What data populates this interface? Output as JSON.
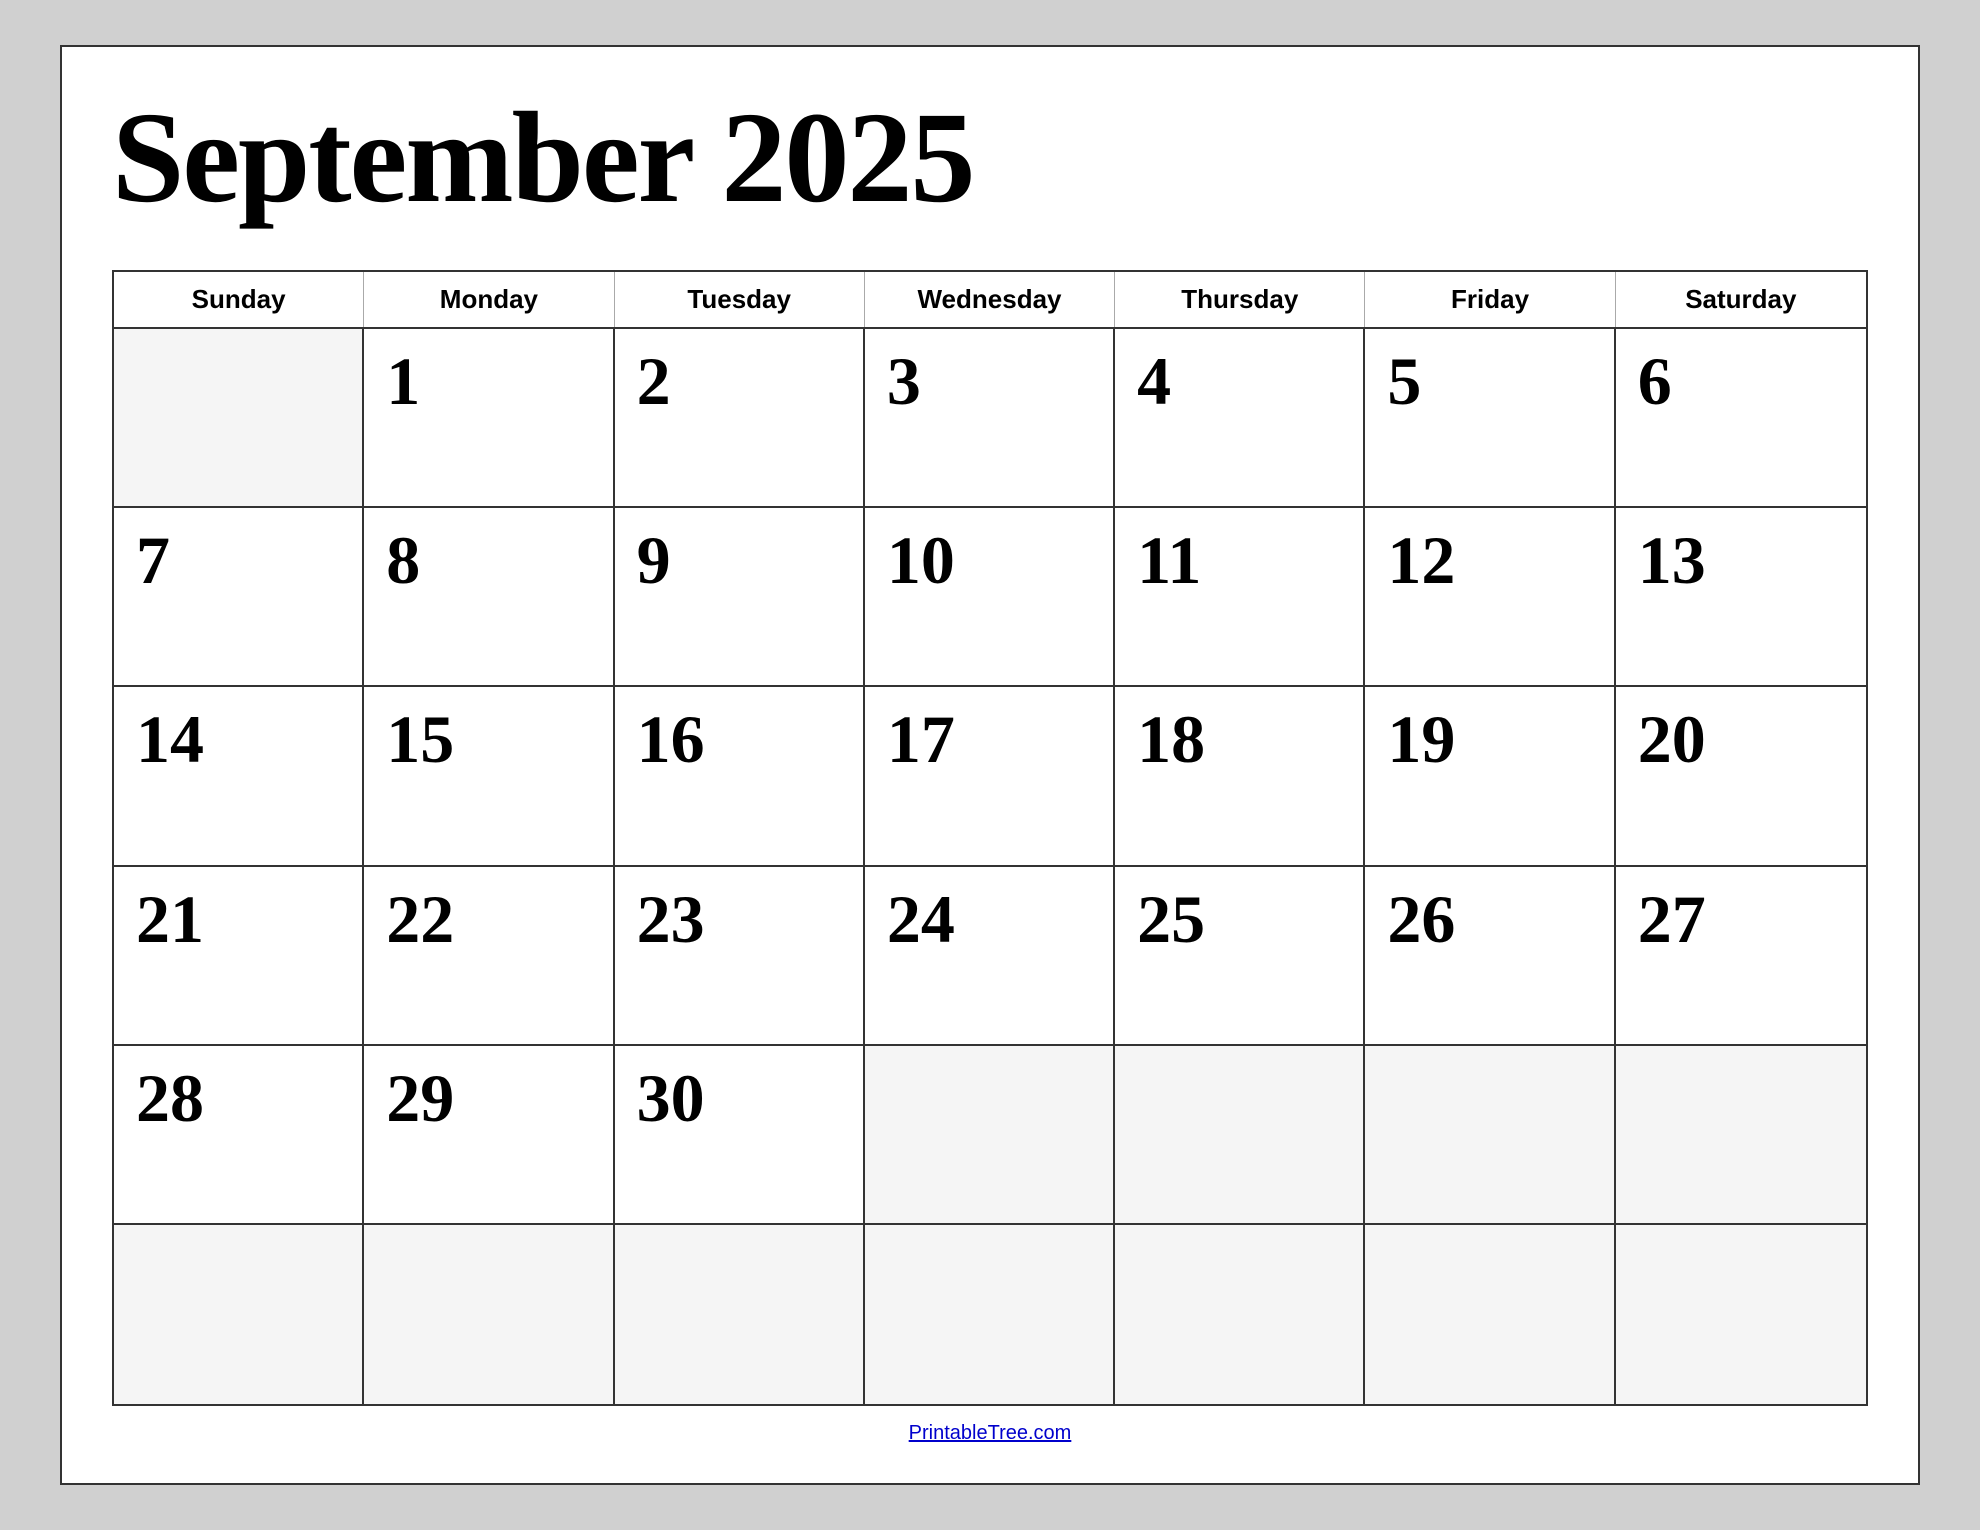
{
  "calendar": {
    "title": "September 2025",
    "footer_link": "PrintableTree.com",
    "day_headers": [
      "Sunday",
      "Monday",
      "Tuesday",
      "Wednesday",
      "Thursday",
      "Friday",
      "Saturday"
    ],
    "weeks": [
      [
        {
          "date": "",
          "empty": true
        },
        {
          "date": "1"
        },
        {
          "date": "2"
        },
        {
          "date": "3"
        },
        {
          "date": "4"
        },
        {
          "date": "5"
        },
        {
          "date": "6"
        }
      ],
      [
        {
          "date": "7"
        },
        {
          "date": "8"
        },
        {
          "date": "9"
        },
        {
          "date": "10"
        },
        {
          "date": "11"
        },
        {
          "date": "12"
        },
        {
          "date": "13"
        }
      ],
      [
        {
          "date": "14"
        },
        {
          "date": "15"
        },
        {
          "date": "16"
        },
        {
          "date": "17"
        },
        {
          "date": "18"
        },
        {
          "date": "19"
        },
        {
          "date": "20"
        }
      ],
      [
        {
          "date": "21"
        },
        {
          "date": "22"
        },
        {
          "date": "23"
        },
        {
          "date": "24"
        },
        {
          "date": "25"
        },
        {
          "date": "26"
        },
        {
          "date": "27"
        }
      ],
      [
        {
          "date": "28"
        },
        {
          "date": "29"
        },
        {
          "date": "30"
        },
        {
          "date": "",
          "empty": true
        },
        {
          "date": "",
          "empty": true
        },
        {
          "date": "",
          "empty": true
        },
        {
          "date": "",
          "empty": true
        }
      ],
      [
        {
          "date": "",
          "empty": true
        },
        {
          "date": "",
          "empty": true
        },
        {
          "date": "",
          "empty": true
        },
        {
          "date": "",
          "empty": true
        },
        {
          "date": "",
          "empty": true
        },
        {
          "date": "",
          "empty": true
        },
        {
          "date": "",
          "empty": true
        }
      ]
    ]
  }
}
